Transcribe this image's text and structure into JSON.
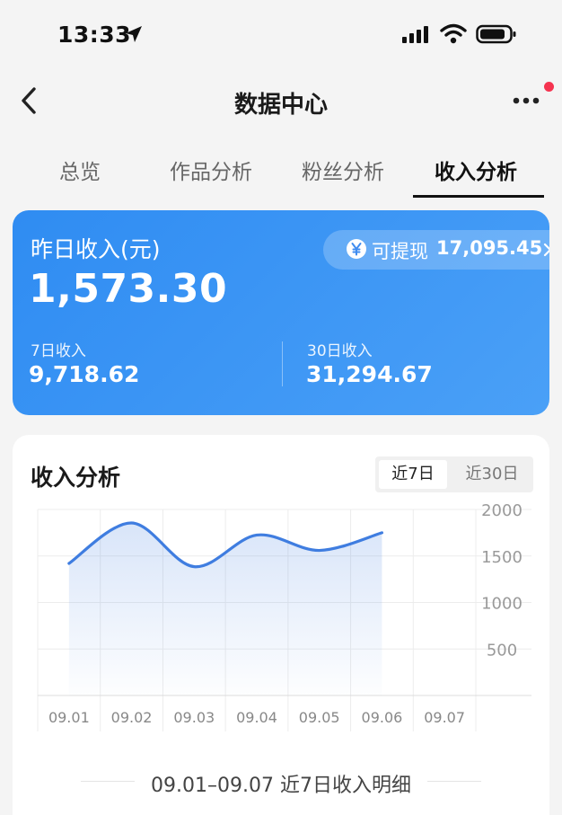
{
  "status_bar": {
    "time": "13:33"
  },
  "nav": {
    "title": "数据中心"
  },
  "tabs": [
    {
      "label": "总览",
      "active": false
    },
    {
      "label": "作品分析",
      "active": false
    },
    {
      "label": "粉丝分析",
      "active": false
    },
    {
      "label": "收入分析",
      "active": true
    }
  ],
  "income_card": {
    "title": "昨日收入(元)",
    "yesterday_value": "1,573.30",
    "withdraw_label": "可提现",
    "withdraw_value": "17,095.45",
    "seven_day_label": "7日收入",
    "seven_day_value": "9,718.62",
    "thirty_day_label": "30日收入",
    "thirty_day_value": "31,294.67",
    "gradient_start": "#2f8cf2",
    "gradient_end": "#4aa0f7"
  },
  "analysis": {
    "title": "收入分析",
    "range_options": [
      "近7日",
      "近30日"
    ],
    "selected_range": "近7日",
    "detail_text": "09.01–09.07 近7日收入明细"
  },
  "chart_data": {
    "type": "area",
    "categories": [
      "09.01",
      "09.02",
      "09.03",
      "09.04",
      "09.05",
      "09.06",
      "09.07"
    ],
    "series": [
      {
        "values": [
          1420,
          1855,
          1385,
          1725,
          1560,
          1750,
          null
        ],
        "color": "#3f7de0"
      }
    ],
    "y_ticks": [
      2000,
      1500,
      1000,
      500
    ],
    "ylim": [
      0,
      2000
    ],
    "grid": true,
    "y_axis_position": "right"
  },
  "colors": {
    "accent": "#3f7de0",
    "notification_dot": "#f5334f"
  }
}
